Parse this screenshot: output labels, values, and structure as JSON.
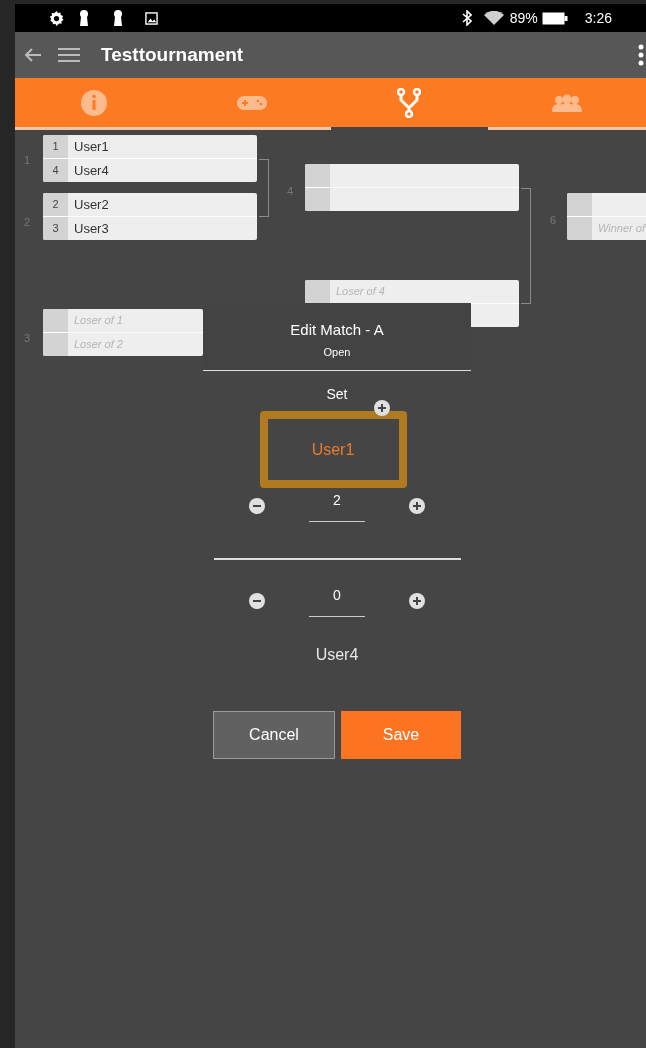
{
  "status_bar": {
    "battery": "89%",
    "time": "3:26"
  },
  "app_bar": {
    "title": "Testtournament"
  },
  "tabs": [
    {
      "kind": "info",
      "selected": false
    },
    {
      "kind": "games",
      "selected": false
    },
    {
      "kind": "bracket",
      "selected": true
    },
    {
      "kind": "players",
      "selected": false
    }
  ],
  "bracket": {
    "matches": [
      {
        "number": "1",
        "slots": [
          {
            "kind": "player",
            "seed": "1",
            "name": "User1"
          },
          {
            "kind": "player",
            "seed": "4",
            "name": "User4"
          }
        ]
      },
      {
        "number": "2",
        "slots": [
          {
            "kind": "player",
            "seed": "2",
            "name": "User2"
          },
          {
            "kind": "player",
            "seed": "3",
            "name": "User3"
          }
        ]
      },
      {
        "number": "4",
        "slots": [
          {
            "kind": "empty"
          },
          {
            "kind": "empty"
          }
        ]
      },
      {
        "slots": [
          {
            "kind": "placeholder",
            "name": "Loser of 4"
          },
          {
            "kind": "covered"
          }
        ]
      },
      {
        "number": "3",
        "slots": [
          {
            "kind": "placeholder",
            "name": "Loser of 1"
          },
          {
            "kind": "placeholder",
            "name": "Loser of 2"
          }
        ]
      },
      {
        "number": "6",
        "slots": [
          {
            "kind": "empty"
          },
          {
            "kind": "placeholder",
            "name": "Winner of"
          }
        ]
      }
    ]
  },
  "dialog": {
    "title": "Edit Match - A",
    "status": "Open",
    "set_label": "Set",
    "highlighted_player": "User1",
    "score_1": "2",
    "score_2": "0",
    "player_2": "User4",
    "buttons": [
      {
        "label": "Cancel",
        "kind": "secondary"
      },
      {
        "label": "Save",
        "kind": "primary"
      }
    ]
  }
}
